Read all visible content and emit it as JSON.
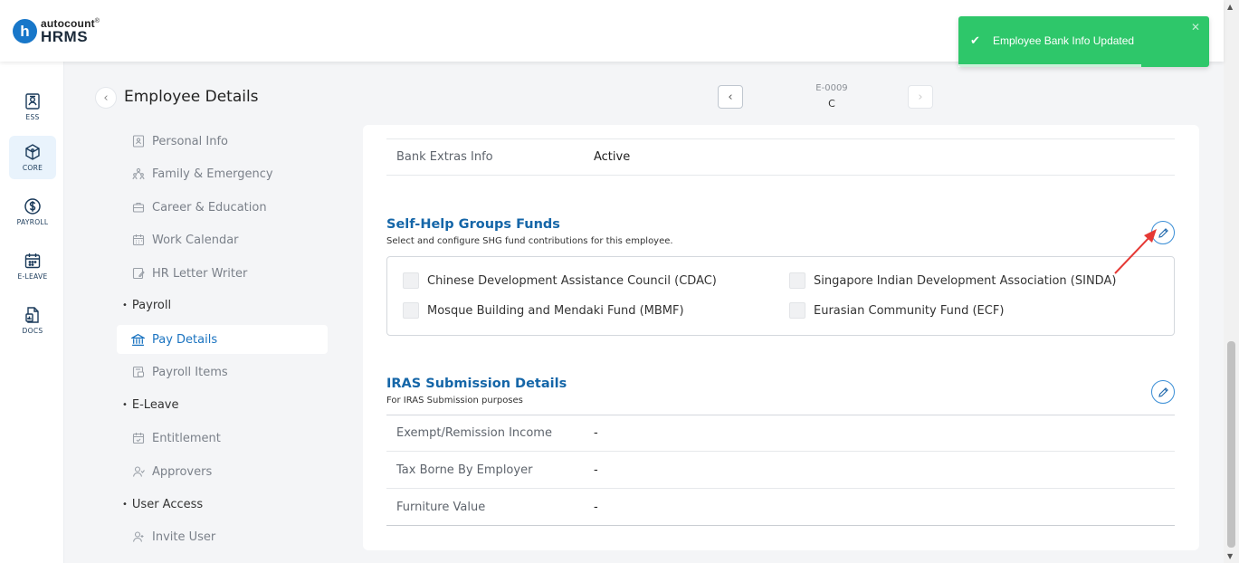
{
  "brand": {
    "logo_letter": "h",
    "line1": "autocount",
    "line1_mark": "®",
    "line2": "HRMS",
    "accent": "#1877c9"
  },
  "rail": {
    "items": [
      {
        "label": "ESS",
        "active": false
      },
      {
        "label": "CORE",
        "active": true
      },
      {
        "label": "PAYROLL",
        "active": false
      },
      {
        "label": "E-LEAVE",
        "active": false
      },
      {
        "label": "DOCS",
        "active": false
      }
    ]
  },
  "page": {
    "title": "Employee Details"
  },
  "employee": {
    "code": "E-0009",
    "name": "C"
  },
  "subnav": {
    "personal_info": "Personal Info",
    "family_emergency": "Family & Emergency",
    "career_education": "Career & Education",
    "work_calendar": "Work Calendar",
    "hr_letter_writer": "HR Letter Writer",
    "group_payroll": "Payroll",
    "pay_details": "Pay Details",
    "payroll_items": "Payroll Items",
    "group_eleave": "E-Leave",
    "entitlement": "Entitlement",
    "approvers": "Approvers",
    "group_user_access": "User Access",
    "invite_user": "Invite User"
  },
  "bank": {
    "extras_label": "Bank Extras Info",
    "extras_value": "Active"
  },
  "shg": {
    "title": "Self-Help Groups Funds",
    "subtitle": "Select and configure SHG fund contributions for this employee.",
    "options": {
      "cdac": "Chinese Development Assistance Council (CDAC)",
      "sinda": "Singapore Indian Development Association (SINDA)",
      "mbmf": "Mosque Building and Mendaki Fund (MBMF)",
      "ecf": "Eurasian Community Fund (ECF)"
    }
  },
  "iras": {
    "title": "IRAS Submission Details",
    "subtitle": "For IRAS Submission purposes",
    "rows": [
      {
        "label": "Exempt/Remission Income",
        "value": "-"
      },
      {
        "label": "Tax Borne By Employer",
        "value": "-"
      },
      {
        "label": "Furniture Value",
        "value": "-"
      }
    ]
  },
  "toast": {
    "message": "Employee Bank Info Updated",
    "close": "✕",
    "color": "#2ec76a",
    "progress": 0.73
  },
  "colors": {
    "section_title": "#1566a8",
    "active_nav": "#1a73c0",
    "annotation_arrow": "#e53935"
  }
}
